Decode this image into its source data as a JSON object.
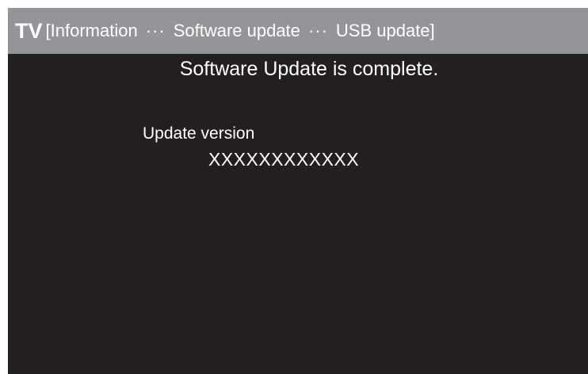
{
  "header": {
    "device": "TV",
    "breadcrumb_open": "[",
    "crumbs": [
      "Information",
      "Software update",
      "USB update"
    ],
    "separator": "···",
    "breadcrumb_close": "]"
  },
  "main": {
    "message": "Software Update is complete.",
    "version_label": "Update version",
    "version_value": "XXXXXXXXXXXX"
  },
  "colors": {
    "header_bg": "#939598",
    "screen_bg": "#231f20",
    "text": "#ffffff"
  }
}
